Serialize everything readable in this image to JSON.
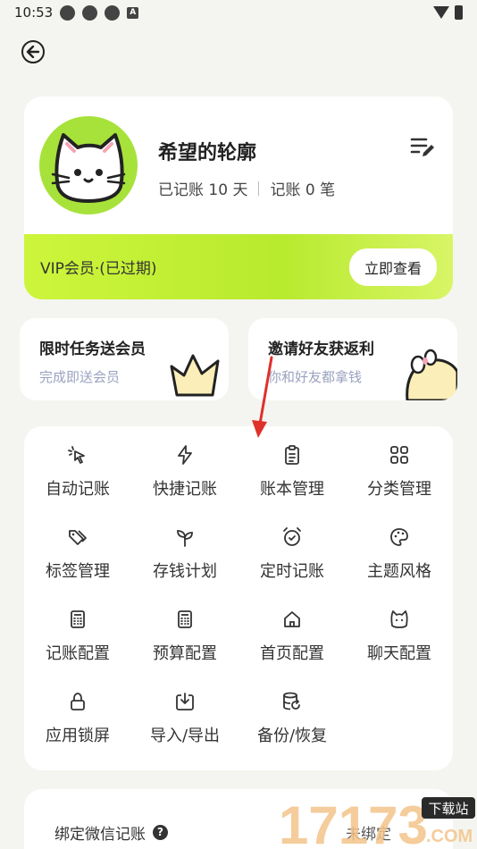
{
  "status_bar": {
    "time": "10:53",
    "a_badge": "A"
  },
  "profile": {
    "username": "希望的轮廓",
    "days_text": "已记账 10 天",
    "count_text": "记账 0 笔",
    "vip_label": "VIP会员·(已过期)",
    "vip_button": "立即查看"
  },
  "promos": [
    {
      "title": "限时任务送会员",
      "subtitle": "完成即送会员"
    },
    {
      "title": "邀请好友获返利",
      "subtitle": "你和好友都拿钱"
    }
  ],
  "grid": [
    {
      "label": "自动记账",
      "icon": "pointer-click-icon"
    },
    {
      "label": "快捷记账",
      "icon": "lightning-icon"
    },
    {
      "label": "账本管理",
      "icon": "clipboard-icon"
    },
    {
      "label": "分类管理",
      "icon": "grid-icon"
    },
    {
      "label": "标签管理",
      "icon": "tags-icon"
    },
    {
      "label": "存钱计划",
      "icon": "sprout-icon"
    },
    {
      "label": "定时记账",
      "icon": "alarm-clock-icon"
    },
    {
      "label": "主题风格",
      "icon": "palette-icon"
    },
    {
      "label": "记账配置",
      "icon": "calculator-icon"
    },
    {
      "label": "预算配置",
      "icon": "calculator-icon"
    },
    {
      "label": "首页配置",
      "icon": "home-icon"
    },
    {
      "label": "聊天配置",
      "icon": "cat-face-icon"
    },
    {
      "label": "应用锁屏",
      "icon": "lock-icon"
    },
    {
      "label": "导入/导出",
      "icon": "download-box-icon"
    },
    {
      "label": "备份/恢复",
      "icon": "database-restore-icon"
    }
  ],
  "wechat": {
    "label": "绑定微信记账",
    "status": "未绑定"
  },
  "watermark": {
    "text": "17173",
    "badge": "下载站",
    "domain": ".COM"
  },
  "colors": {
    "accent": "#a7e23a",
    "background": "#f4f5f0",
    "arrow": "#e0302a"
  }
}
